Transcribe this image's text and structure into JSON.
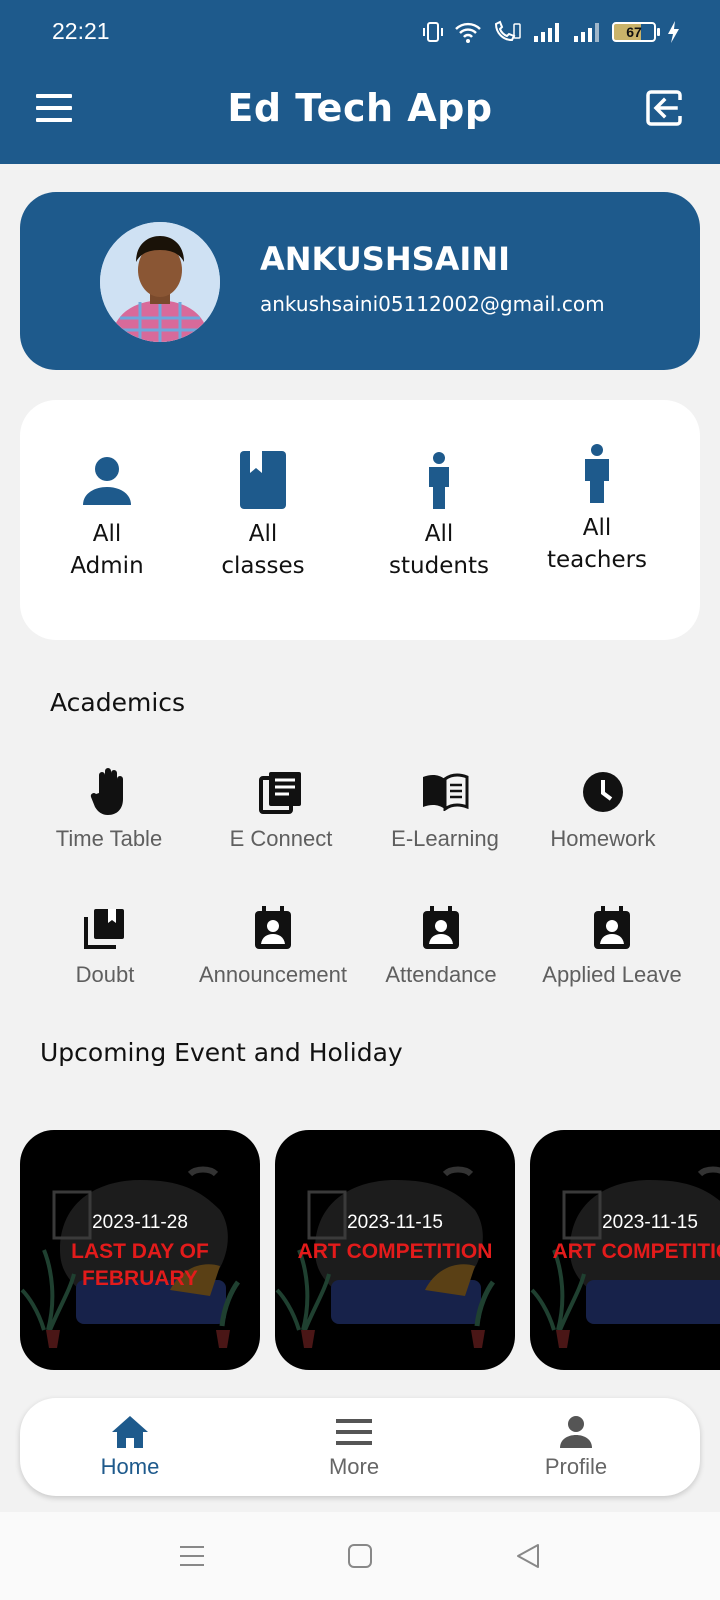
{
  "status_bar": {
    "time": "22:21",
    "battery": "67"
  },
  "app_bar": {
    "title": "Ed Tech App"
  },
  "profile": {
    "name": "ANKUSHSAINI",
    "email": "ankushsaini05112002@gmail.com"
  },
  "quick_links": [
    {
      "line1": "All",
      "line2": "Admin",
      "icon": "person-icon"
    },
    {
      "line1": "All",
      "line2": "classes",
      "icon": "book-icon"
    },
    {
      "line1": "All",
      "line2": "students",
      "icon": "student-icon"
    },
    {
      "line1": "All",
      "line2": "teachers",
      "icon": "teacher-icon"
    }
  ],
  "academics": {
    "title": "Academics",
    "items": [
      {
        "label": "Time Table",
        "icon": "hand-icon"
      },
      {
        "label": "E Connect",
        "icon": "article-icon"
      },
      {
        "label": "E-Learning",
        "icon": "open-book-icon"
      },
      {
        "label": "Homework",
        "icon": "clock-icon"
      },
      {
        "label": "Doubt",
        "icon": "library-books-icon"
      },
      {
        "label": "Announcement",
        "icon": "contact-calendar-icon"
      },
      {
        "label": "Attendance",
        "icon": "contact-calendar-icon"
      },
      {
        "label": "Applied Leave",
        "icon": "contact-calendar-icon"
      }
    ]
  },
  "events": {
    "title": "Upcoming Event and Holiday",
    "items": [
      {
        "date": "2023-11-28",
        "title": "LAST DAY OF FEBRUARY"
      },
      {
        "date": "2023-11-15",
        "title": "ART COMPETITION"
      },
      {
        "date": "2023-11-15",
        "title": "ART COMPETITION"
      }
    ]
  },
  "bottom_nav": {
    "home": "Home",
    "more": "More",
    "profile": "Profile"
  },
  "colors": {
    "primary": "#1e5a8c",
    "background": "#f2f2f2",
    "event_title": "#e31b1b"
  }
}
